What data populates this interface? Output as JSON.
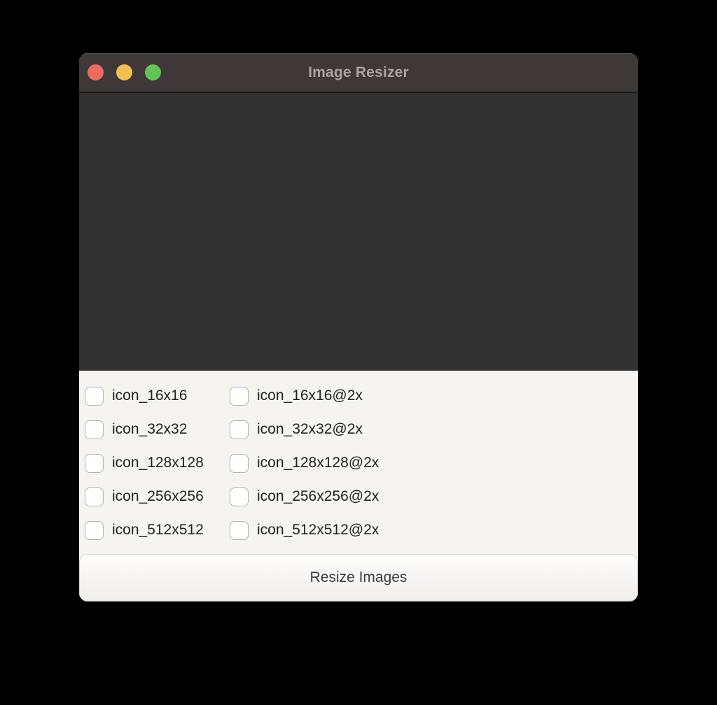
{
  "window": {
    "title": "Image Resizer",
    "traffic_lights": [
      {
        "name": "close",
        "color": "#ed6a5e"
      },
      {
        "name": "minimize",
        "color": "#f4bf4f"
      },
      {
        "name": "zoom",
        "color": "#61c454"
      }
    ]
  },
  "colors": {
    "titlebar_bg": "#3e3839",
    "dropzone_bg": "#323233",
    "panel_bg": "#f5f4f1",
    "title_text": "#a8a4a5",
    "label_text": "#212121",
    "button_text": "#363d44"
  },
  "options": [
    {
      "label": "icon_16x16",
      "checked": false
    },
    {
      "label": "icon_16x16@2x",
      "checked": false
    },
    {
      "label": "icon_32x32",
      "checked": false
    },
    {
      "label": "icon_32x32@2x",
      "checked": false
    },
    {
      "label": "icon_128x128",
      "checked": false
    },
    {
      "label": "icon_128x128@2x",
      "checked": false
    },
    {
      "label": "icon_256x256",
      "checked": false
    },
    {
      "label": "icon_256x256@2x",
      "checked": false
    },
    {
      "label": "icon_512x512",
      "checked": false
    },
    {
      "label": "icon_512x512@2x",
      "checked": false
    }
  ],
  "button": {
    "label": "Resize Images"
  }
}
